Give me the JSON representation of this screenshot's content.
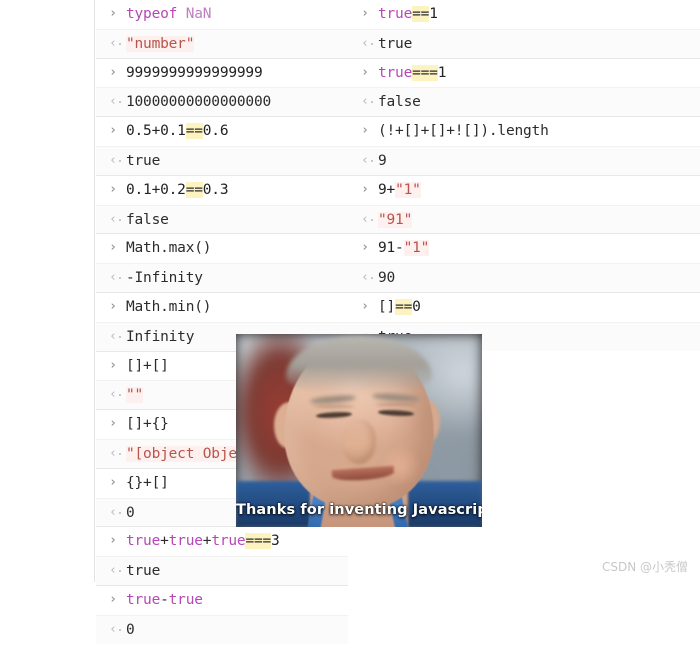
{
  "console": {
    "prompt_input_glyph": "›",
    "prompt_output_glyph": "‹",
    "columns": [
      {
        "name": "left-column",
        "groups": [
          {
            "input": "typeof NaN",
            "output": "\"number\"",
            "input_tokens": [
              {
                "t": "typeof",
                "c": "kw"
              },
              {
                "t": " ",
                "c": "plain"
              },
              {
                "t": "NaN",
                "c": "ident"
              }
            ],
            "output_kind": "string"
          },
          {
            "input": "9999999999999999",
            "output": "10000000000000000",
            "input_tokens": [
              {
                "t": "9999999999999999",
                "c": "num"
              }
            ],
            "output_kind": "number"
          },
          {
            "input": "0.5+0.1==0.6",
            "output": "true",
            "input_tokens": [
              {
                "t": "0.5+0.1",
                "c": "num"
              },
              {
                "t": "==",
                "c": "hl"
              },
              {
                "t": "0.6",
                "c": "num"
              }
            ],
            "output_kind": "boolean"
          },
          {
            "input": "0.1+0.2==0.3",
            "output": "false",
            "input_tokens": [
              {
                "t": "0.1+0.2",
                "c": "num"
              },
              {
                "t": "==",
                "c": "hl"
              },
              {
                "t": "0.3",
                "c": "num"
              }
            ],
            "output_kind": "boolean"
          },
          {
            "input": "Math.max()",
            "output": "-Infinity",
            "input_tokens": [
              {
                "t": "Math.max()",
                "c": "plain"
              }
            ],
            "output_kind": "number"
          },
          {
            "input": "Math.min()",
            "output": "Infinity",
            "input_tokens": [
              {
                "t": "Math.min()",
                "c": "plain"
              }
            ],
            "output_kind": "number"
          },
          {
            "input": "[]+[]",
            "output": "\"\"",
            "input_tokens": [
              {
                "t": "[]+[]",
                "c": "plain"
              }
            ],
            "output_kind": "string"
          },
          {
            "input": "[]+{}",
            "output": "\"[object Object]\"",
            "input_tokens": [
              {
                "t": "[]+{}",
                "c": "plain"
              }
            ],
            "output_kind": "string"
          },
          {
            "input": "{}+[]",
            "output": "0",
            "input_tokens": [
              {
                "t": "{}+[]",
                "c": "plain"
              }
            ],
            "output_kind": "number"
          },
          {
            "input": "true+true+true===3",
            "output": "true",
            "input_tokens": [
              {
                "t": "true",
                "c": "kw"
              },
              {
                "t": "+",
                "c": "plain"
              },
              {
                "t": "true",
                "c": "kw"
              },
              {
                "t": "+",
                "c": "plain"
              },
              {
                "t": "true",
                "c": "kw"
              },
              {
                "t": "===",
                "c": "hl"
              },
              {
                "t": "3",
                "c": "num"
              }
            ],
            "output_kind": "boolean"
          },
          {
            "input": "true-true",
            "output": "0",
            "input_tokens": [
              {
                "t": "true",
                "c": "kw"
              },
              {
                "t": "-",
                "c": "plain"
              },
              {
                "t": "true",
                "c": "kw"
              }
            ],
            "output_kind": "number"
          }
        ]
      },
      {
        "name": "right-column",
        "groups": [
          {
            "input": "true==1",
            "output": "true",
            "input_tokens": [
              {
                "t": "true",
                "c": "kw"
              },
              {
                "t": "==",
                "c": "hl"
              },
              {
                "t": "1",
                "c": "num"
              }
            ],
            "output_kind": "boolean"
          },
          {
            "input": "true===1",
            "output": "false",
            "input_tokens": [
              {
                "t": "true",
                "c": "kw"
              },
              {
                "t": "===",
                "c": "hl"
              },
              {
                "t": "1",
                "c": "num"
              }
            ],
            "output_kind": "boolean"
          },
          {
            "input": "(!+[]+[]+![]).length",
            "output": "9",
            "input_tokens": [
              {
                "t": "(!+[]+[]+![]).length",
                "c": "plain"
              }
            ],
            "output_kind": "number"
          },
          {
            "input": "9+\"1\"",
            "output": "\"91\"",
            "input_tokens": [
              {
                "t": "9+",
                "c": "num"
              },
              {
                "t": "\"1\"",
                "c": "str"
              }
            ],
            "output_kind": "string"
          },
          {
            "input": "91-\"1\"",
            "output": "90",
            "input_tokens": [
              {
                "t": "91-",
                "c": "num"
              },
              {
                "t": "\"1\"",
                "c": "str"
              }
            ],
            "output_kind": "number"
          },
          {
            "input": "[]==0",
            "output": "true",
            "input_tokens": [
              {
                "t": "[]",
                "c": "plain"
              },
              {
                "t": "==",
                "c": "hl"
              },
              {
                "t": "0",
                "c": "num"
              }
            ],
            "output_kind": "boolean"
          }
        ]
      }
    ]
  },
  "meme": {
    "caption": "Thanks for inventing Javascript",
    "alt": "smirking-man-photo"
  },
  "watermark": {
    "text": "CSDN @小秃僧"
  },
  "colors": {
    "keyword": "#b648b6",
    "identifier": "#c07ec0",
    "string": "#b8554b",
    "highlight": "#fdf3c0",
    "plain": "#2b2b2b",
    "rule": "#e8e8e8",
    "output_bg": "#fbfbfb",
    "caption": "#ffffff",
    "watermark": "#c8c8c8"
  }
}
